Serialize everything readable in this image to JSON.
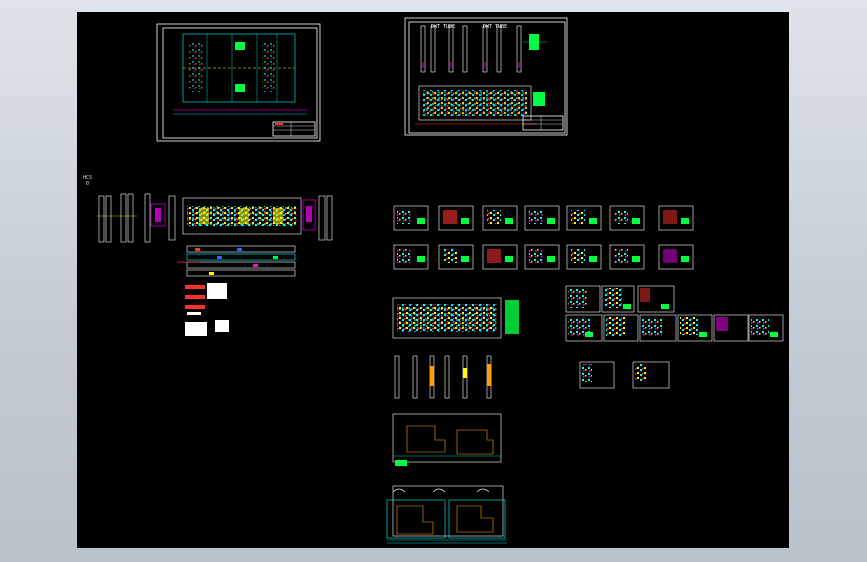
{
  "viewport": {
    "background": "#c9d0d8",
    "canvas_background": "#000000",
    "view_label": "HCS\n 0",
    "title_stamp_a": "DWT TUBE",
    "title_stamp_b": "DWT TUBE"
  },
  "colors": {
    "white": "#ffffff",
    "cyan": "#00ffff",
    "yellow": "#ffff00",
    "magenta": "#ff00ff",
    "red": "#ff3030",
    "green": "#00ff40",
    "blue": "#3060ff",
    "orange": "#ffa000"
  },
  "icons": [
    "drawing-sheet",
    "part-detail",
    "section-strip"
  ]
}
